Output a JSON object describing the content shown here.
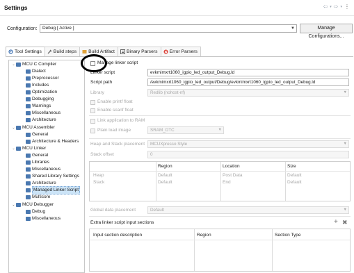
{
  "window": {
    "title": "Settings"
  },
  "configuration": {
    "label": "Configuration:",
    "value": "Debug  [ Active ]",
    "manage_button": "Manage Configurations..."
  },
  "tabs": [
    {
      "label": "Tool Settings",
      "icon": "tool-settings-icon",
      "active": true
    },
    {
      "label": "Build steps",
      "icon": "build-steps-icon"
    },
    {
      "label": "Build Artifact",
      "icon": "build-artifact-icon"
    },
    {
      "label": "Binary Parsers",
      "icon": "binary-parsers-icon"
    },
    {
      "label": "Error Parsers",
      "icon": "error-parsers-icon"
    }
  ],
  "tree": [
    {
      "label": "MCU C Compiler",
      "level": 0,
      "expanded": true
    },
    {
      "label": "Dialect",
      "level": 1
    },
    {
      "label": "Preprocessor",
      "level": 1
    },
    {
      "label": "Includes",
      "level": 1
    },
    {
      "label": "Optimization",
      "level": 1
    },
    {
      "label": "Debugging",
      "level": 1
    },
    {
      "label": "Warnings",
      "level": 1
    },
    {
      "label": "Miscellaneous",
      "level": 1
    },
    {
      "label": "Architecture",
      "level": 1
    },
    {
      "label": "MCU Assembler",
      "level": 0,
      "expanded": true
    },
    {
      "label": "General",
      "level": 1
    },
    {
      "label": "Architecture & Headers",
      "level": 1
    },
    {
      "label": "MCU Linker",
      "level": 0,
      "expanded": true
    },
    {
      "label": "General",
      "level": 1
    },
    {
      "label": "Libraries",
      "level": 1
    },
    {
      "label": "Miscellaneous",
      "level": 1
    },
    {
      "label": "Shared Library Settings",
      "level": 1
    },
    {
      "label": "Architecture",
      "level": 1
    },
    {
      "label": "Managed Linker Script",
      "level": 1,
      "selected": true
    },
    {
      "label": "Multicore",
      "level": 1
    },
    {
      "label": "MCU Debugger",
      "level": 0,
      "expanded": true
    },
    {
      "label": "Debug",
      "level": 1
    },
    {
      "label": "Miscellaneous",
      "level": 1
    }
  ],
  "linker": {
    "manage_linker_script": "Manage linker script",
    "script_label": "Linker script",
    "script_value": "evkmimxrt1060_igpio_led_output_Debug.ld",
    "script_path_label": "Script path",
    "script_path_value": "/evkmimxrt1060_igpio_led_output/Debug/evkmimxrt1060_igpio_led_output_Debug.ld",
    "library_label": "Library",
    "library_value": "Redlib (nohost-nf)",
    "enable_printf_float": "Enable printf float",
    "enable_scanf_float": "Enable scanf float",
    "link_to_ram": "Link application to RAM",
    "plain_load_image": "Plain load image",
    "plain_load_value": "SRAM_DTC",
    "heap_stack_placement_label": "Heap and Stack placement",
    "heap_stack_placement_value": "MCUXpresso Style",
    "stack_offset_label": "Stack offset",
    "stack_offset_value": "0"
  },
  "heap_stack_table": {
    "columns": [
      "Region",
      "Location",
      "Size"
    ],
    "rows": [
      [
        "Heap",
        "Default",
        "Post Data",
        "Default"
      ],
      [
        "Stack",
        "Default",
        "End",
        "Default"
      ]
    ]
  },
  "global_data": {
    "label": "Global data placement",
    "value": "Default"
  },
  "extra_sections": {
    "title": "Extra linker script input sections",
    "columns": [
      "Input section description",
      "Region",
      "Section Type"
    ]
  }
}
